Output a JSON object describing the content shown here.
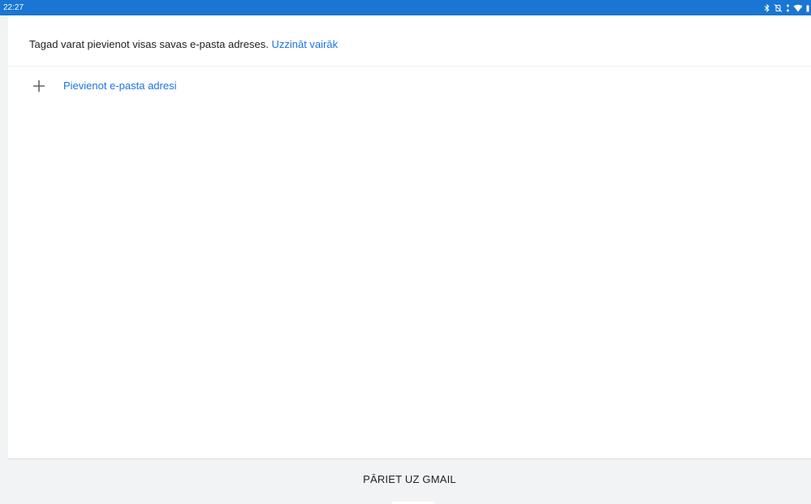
{
  "status_bar": {
    "time": "22:27",
    "icons": [
      "bluetooth-icon",
      "vibrate-off-icon",
      "data-arrows-icon",
      "wifi-icon",
      "battery-icon"
    ]
  },
  "info": {
    "text": "Tagad varat pievienot visas savas e-pasta adreses. ",
    "link_label": "Uzzināt vairāk"
  },
  "add_email": {
    "icon": "plus-icon",
    "label": "Pievienot e-pasta adresi"
  },
  "footer": {
    "button_label": "PĀRIET UZ GMAIL"
  },
  "colors": {
    "status_bar": "#1976d2",
    "accent": "#1a73e8",
    "background": "#f1f3f4"
  }
}
